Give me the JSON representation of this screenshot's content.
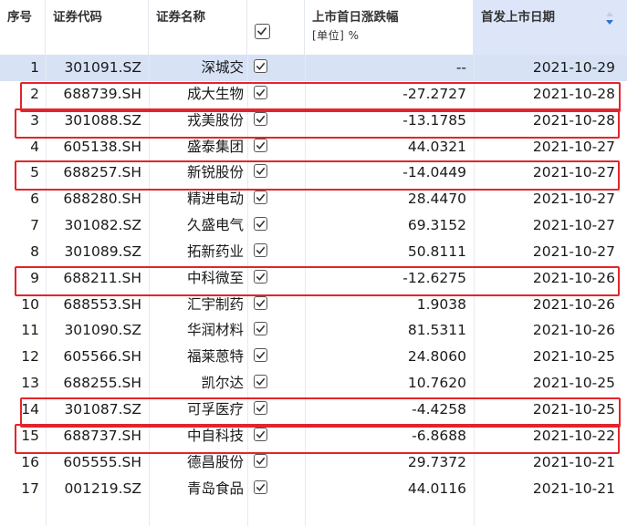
{
  "headers": {
    "index": "序号",
    "code": "证券代码",
    "name": "证券名称",
    "change": "上市首日涨跌幅",
    "unit": "[单位]  %",
    "date": "首发上市日期"
  },
  "rows": [
    {
      "idx": "1",
      "code": "301091.SZ",
      "name": "深城交",
      "change": "--",
      "date": "2021-10-29"
    },
    {
      "idx": "2",
      "code": "688739.SH",
      "name": "成大生物",
      "change": "-27.2727",
      "date": "2021-10-28"
    },
    {
      "idx": "3",
      "code": "301088.SZ",
      "name": "戎美股份",
      "change": "-13.1785",
      "date": "2021-10-28"
    },
    {
      "idx": "4",
      "code": "605138.SH",
      "name": "盛泰集团",
      "change": "44.0321",
      "date": "2021-10-27"
    },
    {
      "idx": "5",
      "code": "688257.SH",
      "name": "新锐股份",
      "change": "-14.0449",
      "date": "2021-10-27"
    },
    {
      "idx": "6",
      "code": "688280.SH",
      "name": "精进电动",
      "change": "28.4470",
      "date": "2021-10-27"
    },
    {
      "idx": "7",
      "code": "301082.SZ",
      "name": "久盛电气",
      "change": "69.3152",
      "date": "2021-10-27"
    },
    {
      "idx": "8",
      "code": "301089.SZ",
      "name": "拓新药业",
      "change": "50.8111",
      "date": "2021-10-27"
    },
    {
      "idx": "9",
      "code": "688211.SH",
      "name": "中科微至",
      "change": "-12.6275",
      "date": "2021-10-26"
    },
    {
      "idx": "10",
      "code": "688553.SH",
      "name": "汇宇制药",
      "change": "1.9038",
      "date": "2021-10-26"
    },
    {
      "idx": "11",
      "code": "301090.SZ",
      "name": "华润材料",
      "change": "81.5311",
      "date": "2021-10-26"
    },
    {
      "idx": "12",
      "code": "605566.SH",
      "name": "福莱蒽特",
      "change": "24.8060",
      "date": "2021-10-25"
    },
    {
      "idx": "13",
      "code": "688255.SH",
      "name": "凯尔达",
      "change": "10.7620",
      "date": "2021-10-25"
    },
    {
      "idx": "14",
      "code": "301087.SZ",
      "name": "可孚医疗",
      "change": "-4.4258",
      "date": "2021-10-25"
    },
    {
      "idx": "15",
      "code": "688737.SH",
      "name": "中自科技",
      "change": "-6.8688",
      "date": "2021-10-22"
    },
    {
      "idx": "16",
      "code": "605555.SH",
      "name": "德昌股份",
      "change": "29.7372",
      "date": "2021-10-21"
    },
    {
      "idx": "17",
      "code": "001219.SZ",
      "name": "青岛食品",
      "change": "44.0116",
      "date": "2021-10-21"
    }
  ],
  "selected_row": "1",
  "highlighted_rows": [
    "2",
    "3",
    "5",
    "9",
    "14",
    "15"
  ],
  "colors": {
    "highlight_border": "#e3242b",
    "selected_row_bg": "#d7e2f5",
    "sorted_header_bg": "#dde6f8"
  },
  "sort": {
    "column": "date",
    "direction": "descending"
  }
}
